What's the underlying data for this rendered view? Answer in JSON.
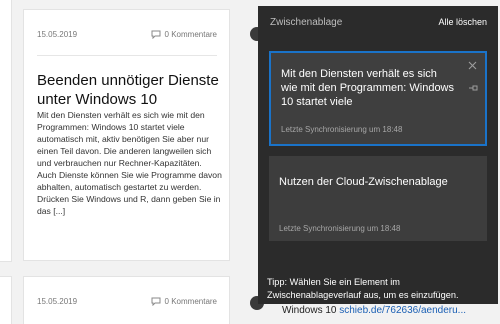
{
  "blog": {
    "main_card": {
      "date": "15.05.2019",
      "comments": "0 Kommentare",
      "title": "Beenden unnötiger Dienste unter Windows 10",
      "excerpt": "Mit den Diensten verhält es sich wie mit den Programmen: Windows 10 startet viele automatisch mit, aktiv benötigen Sie aber nur einen Teil davon. Die anderen langweilen sich und verbrauchen nur Rechner-Kapazitäten. Auch Dienste können Sie wie Programme davon abhalten, automatisch gestartet zu werden.   Drücken Sie Windows und R, dann geben Sie in das [...]"
    },
    "bottom_card": {
      "date": "15.05.2019",
      "comments": "0 Kommentare"
    },
    "footer_text": "Windows 10",
    "footer_link": "schieb.de/762636/aenderu..."
  },
  "clipboard": {
    "title": "Zwischenablage",
    "clear_all": "Alle löschen",
    "items": [
      {
        "text": "Mit den Diensten verhält es sich wie mit den Programmen: Windows 10 startet viele",
        "sync": "Letzte Synchronisierung um 18:48"
      },
      {
        "text": "Nutzen der Cloud-Zwischenablage",
        "sync": "Letzte Synchronisierung um 18:48"
      }
    ],
    "tip": "Tipp: Wählen Sie ein Element im Zwischenablageverlauf aus, um es einzufügen."
  },
  "colors": {
    "panel_bg": "#2b2b2b",
    "item_bg": "#3d3d3d",
    "selected_border": "#1a73c9"
  },
  "icons": {
    "comments": "speech-bubble-icon",
    "close": "close-icon",
    "pin": "pin-icon"
  }
}
